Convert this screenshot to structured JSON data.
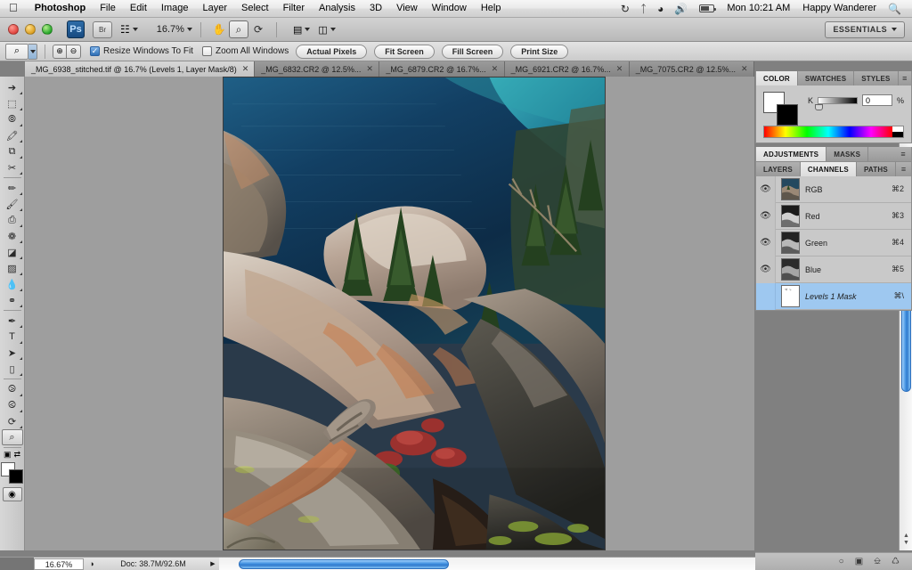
{
  "menubar": {
    "apple_icon": "apple-icon",
    "app_name": "Photoshop",
    "items": [
      "File",
      "Edit",
      "Image",
      "Layer",
      "Select",
      "Filter",
      "Analysis",
      "3D",
      "View",
      "Window",
      "Help"
    ],
    "status_icons": [
      "sync-icon",
      "bluetooth-icon",
      "wifi-icon",
      "volume-icon",
      "battery-icon"
    ],
    "clock": "Mon 10:21 AM",
    "user": "Happy Wanderer",
    "search_icon": "search-icon"
  },
  "appbar": {
    "bridge_label": "Br",
    "view_extras_icon": "view-extras-icon",
    "zoom_level": "16.7%",
    "hand_icon": "hand-tool-icon",
    "zoom_icon": "zoom-tool-icon",
    "rotate_icon": "rotate-view-icon",
    "arrange_icon": "arrange-documents-icon",
    "screenmode_icon": "screen-mode-icon",
    "workspace": "ESSENTIALS"
  },
  "options": {
    "tool_icon": "zoom-tool-icon",
    "zoom_in_icon": "zoom-in-icon",
    "zoom_out_icon": "zoom-out-icon",
    "resize_windows_label": "Resize Windows To Fit",
    "resize_windows_checked": true,
    "zoom_all_label": "Zoom All Windows",
    "zoom_all_checked": false,
    "buttons": [
      "Actual Pixels",
      "Fit Screen",
      "Fill Screen",
      "Print Size"
    ]
  },
  "tabs": [
    {
      "label": "_MG_6938_stitched.tif @ 16.7% (Levels 1, Layer Mask/8)",
      "active": true
    },
    {
      "label": "_MG_6832.CR2 @ 12.5%...",
      "active": false
    },
    {
      "label": "_MG_6879.CR2 @ 16.7%...",
      "active": false
    },
    {
      "label": "_MG_6921.CR2 @ 16.7%...",
      "active": false
    },
    {
      "label": "_MG_7075.CR2 @ 12.5%...",
      "active": false
    }
  ],
  "tools": [
    {
      "name": "move-tool",
      "glyph": "↖",
      "active": false
    },
    {
      "name": "marquee-tool",
      "glyph": "⬚",
      "active": false
    },
    {
      "name": "lasso-tool",
      "glyph": "◌",
      "active": false
    },
    {
      "name": "quick-selection-tool",
      "glyph": "✒",
      "active": false
    },
    {
      "name": "crop-tool",
      "glyph": "⧉",
      "active": false
    },
    {
      "name": "eyedropper-tool",
      "glyph": "✐",
      "active": false
    },
    {
      "name": "healing-brush-tool",
      "glyph": "✑",
      "active": false
    },
    {
      "name": "brush-tool",
      "glyph": "✎",
      "active": false
    },
    {
      "name": "clone-stamp-tool",
      "glyph": "⎙",
      "active": false
    },
    {
      "name": "history-brush-tool",
      "glyph": "❁",
      "active": false
    },
    {
      "name": "eraser-tool",
      "glyph": "◪",
      "active": false
    },
    {
      "name": "gradient-tool",
      "glyph": "▨",
      "active": false
    },
    {
      "name": "blur-tool",
      "glyph": "●",
      "active": false
    },
    {
      "name": "dodge-tool",
      "glyph": "⚲",
      "active": false
    },
    {
      "name": "pen-tool",
      "glyph": "✒",
      "active": false
    },
    {
      "name": "type-tool",
      "glyph": "T",
      "active": false
    },
    {
      "name": "path-selection-tool",
      "glyph": "➤",
      "active": false
    },
    {
      "name": "shape-tool",
      "glyph": "▣",
      "active": false
    },
    {
      "name": "3d-rotate-tool",
      "glyph": "⥁",
      "active": false
    },
    {
      "name": "3d-orbit-tool",
      "glyph": "⥀",
      "active": false
    },
    {
      "name": "hand-tool",
      "glyph": "✋",
      "active": false
    },
    {
      "name": "zoom-tool",
      "glyph": "⌕",
      "active": true
    }
  ],
  "color_panel": {
    "tabs": [
      "COLOR",
      "SWATCHES",
      "STYLES"
    ],
    "active_tab": "COLOR",
    "slider_label": "K",
    "slider_value": "0",
    "unit": "%",
    "foreground": "#ffffff",
    "background": "#000000"
  },
  "adjustments_panel": {
    "tabs": [
      "ADJUSTMENTS",
      "MASKS"
    ],
    "active_tab": "ADJUSTMENTS"
  },
  "channels_panel": {
    "tabs": [
      "LAYERS",
      "CHANNELS",
      "PATHS"
    ],
    "active_tab": "CHANNELS",
    "channels": [
      {
        "name": "RGB",
        "shortcut": "⌘2",
        "visible": true,
        "selected": false,
        "italic": false,
        "thumb": "composite"
      },
      {
        "name": "Red",
        "shortcut": "⌘3",
        "visible": true,
        "selected": false,
        "italic": false,
        "thumb": "gray"
      },
      {
        "name": "Green",
        "shortcut": "⌘4",
        "visible": true,
        "selected": false,
        "italic": false,
        "thumb": "gray"
      },
      {
        "name": "Blue",
        "shortcut": "⌘5",
        "visible": true,
        "selected": false,
        "italic": false,
        "thumb": "gray"
      },
      {
        "name": "Levels 1 Mask",
        "shortcut": "⌘\\",
        "visible": false,
        "selected": true,
        "italic": true,
        "thumb": "mask"
      }
    ],
    "footer_icons": [
      "load-channel-as-selection-icon",
      "save-selection-as-channel-icon",
      "create-new-channel-icon",
      "delete-channel-icon"
    ]
  },
  "statusbar": {
    "zoom": "16.67%",
    "preview_icon": "preview-icon",
    "doc_info": "Doc: 38.7M/92.6M",
    "expand_icon": "expand-arrow-icon"
  },
  "canvas": {
    "document_name": "_MG_6938_stitched.tif",
    "description": "alpine lake viewed from rocky overlook with hiker leg and sandal"
  }
}
